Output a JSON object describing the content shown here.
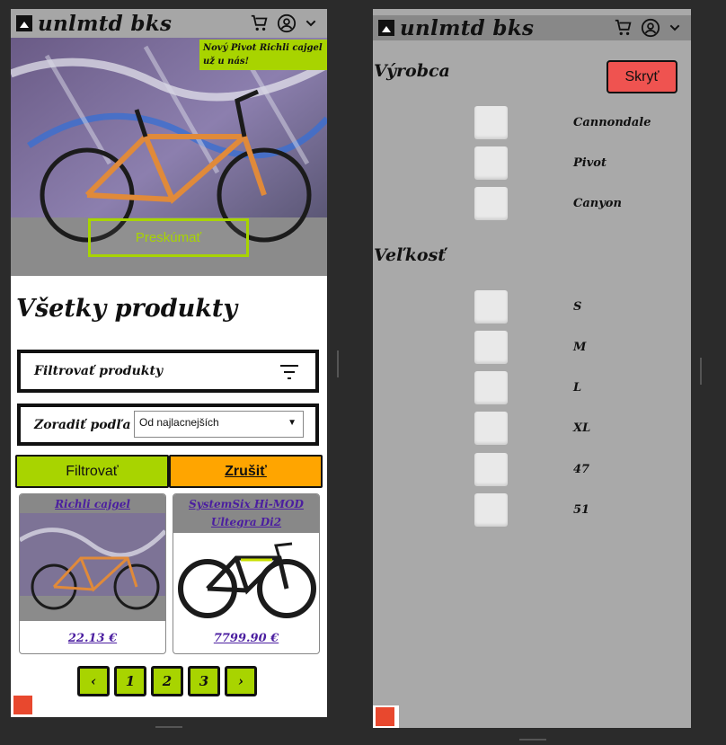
{
  "brand": "unlmtd bks",
  "left": {
    "hero": {
      "banner": "Nový Pivot Richli cajgel už u nás!",
      "explore_label": "Preskúmať"
    },
    "page_title": "Všetky produkty",
    "filter_label": "Filtrovať produkty",
    "sort_label": "Zoradiť podľa",
    "sort_value": "Od najlacnejších",
    "filter_button": "Filtrovať",
    "cancel_button": "Zrušiť",
    "products": [
      {
        "title": "Richli cajgel",
        "price": "22.13 €"
      },
      {
        "title": "SystemSix Hi-MOD Ultegra Di2",
        "price": "7799.90 €"
      }
    ],
    "pager": [
      "‹",
      "1",
      "2",
      "3",
      "›"
    ]
  },
  "right": {
    "manufacturer_title": "Výrobca",
    "hide_button": "Skryť",
    "manufacturers": [
      "Cannondale",
      "Pivot",
      "Canyon"
    ],
    "size_title": "Veľkosť",
    "sizes": [
      "S",
      "M",
      "L",
      "XL",
      "47",
      "51"
    ]
  },
  "colors": {
    "accent_green": "#a8d400",
    "cancel_orange": "#ffa500",
    "hide_red": "#ef5350",
    "link_purple": "#4b1ea0"
  },
  "icons": [
    "cart-icon",
    "account-icon",
    "chevron-down-icon",
    "filter-icon"
  ]
}
